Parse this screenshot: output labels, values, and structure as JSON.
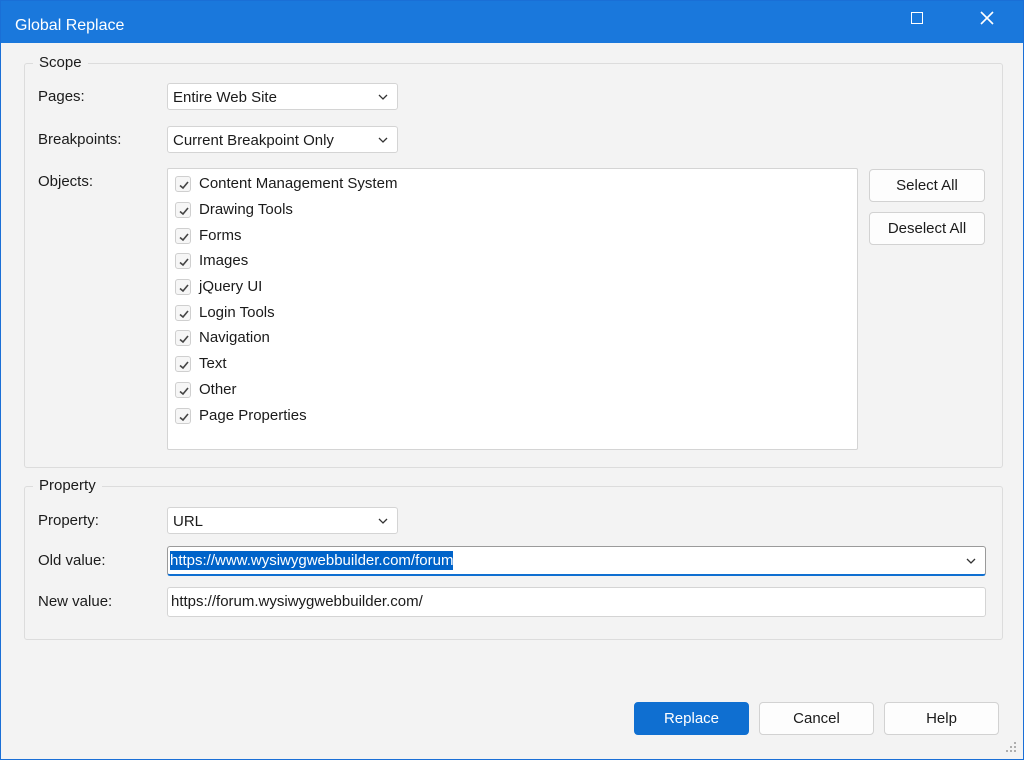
{
  "window": {
    "title": "Global Replace",
    "maximize_icon": "maximize-icon",
    "close_icon": "close-icon"
  },
  "scope": {
    "group_title": "Scope",
    "pages_label": "Pages:",
    "pages_value": "Entire Web Site",
    "breakpoints_label": "Breakpoints:",
    "breakpoints_value": "Current Breakpoint Only",
    "objects_label": "Objects:",
    "objects": [
      {
        "label": "Content Management System",
        "checked": true
      },
      {
        "label": "Drawing Tools",
        "checked": true
      },
      {
        "label": "Forms",
        "checked": true
      },
      {
        "label": "Images",
        "checked": true
      },
      {
        "label": "jQuery UI",
        "checked": true
      },
      {
        "label": "Login Tools",
        "checked": true
      },
      {
        "label": "Navigation",
        "checked": true
      },
      {
        "label": "Text",
        "checked": true
      },
      {
        "label": "Other",
        "checked": true
      },
      {
        "label": "Page Properties",
        "checked": true
      }
    ],
    "select_all": "Select All",
    "deselect_all": "Deselect All"
  },
  "property": {
    "group_title": "Property",
    "property_label": "Property:",
    "property_value": "URL",
    "old_value_label": "Old value:",
    "old_value": "https://www.wysiwygwebbuilder.com/forum",
    "new_value_label": "New value:",
    "new_value": "https://forum.wysiwygwebbuilder.com/"
  },
  "footer": {
    "replace": "Replace",
    "cancel": "Cancel",
    "help": "Help"
  },
  "colors": {
    "titlebar": "#1a78dc",
    "accent": "#0f6fd1"
  }
}
